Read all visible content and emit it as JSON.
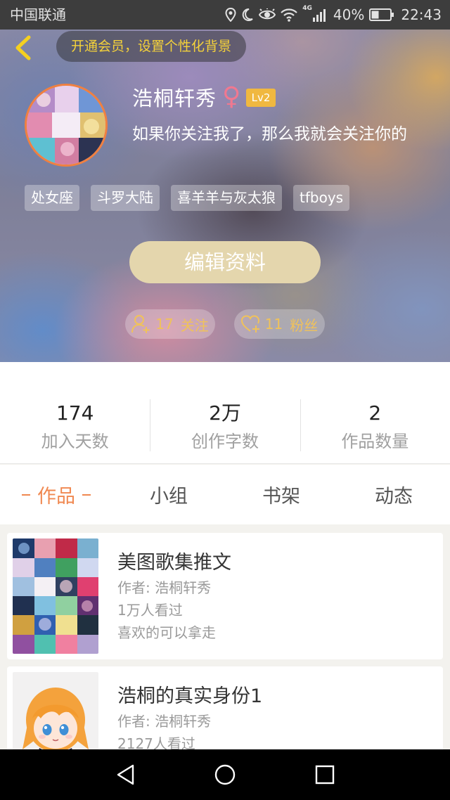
{
  "status_bar": {
    "carrier": "中国联通",
    "network": "4G",
    "battery": "40%",
    "time": "22:43"
  },
  "header": {
    "vip_prompt": "开通会员，设置个性化背景"
  },
  "profile": {
    "name": "浩桐轩秀",
    "gender_symbol": "♀",
    "level": "Lv2",
    "bio": "如果你关注我了，那么我就会关注你的",
    "tags": [
      "处女座",
      "斗罗大陆",
      "喜羊羊与灰太狼",
      "tfboys"
    ],
    "edit_button": "编辑资料",
    "following": {
      "count": "17",
      "label": "关注"
    },
    "followers": {
      "count": "11",
      "label": "粉丝"
    }
  },
  "stats": [
    {
      "value": "174",
      "label": "加入天数"
    },
    {
      "value": "2万",
      "label": "创作字数"
    },
    {
      "value": "2",
      "label": "作品数量"
    }
  ],
  "tabs": [
    {
      "label": "作品",
      "active": true
    },
    {
      "label": "小组",
      "active": false
    },
    {
      "label": "书架",
      "active": false
    },
    {
      "label": "动态",
      "active": false
    }
  ],
  "works": [
    {
      "title": "美图歌集推文",
      "author": "作者: 浩桐轩秀",
      "views": "1万人看过",
      "description": "喜欢的可以拿走"
    },
    {
      "title": "浩桐的真实身份1",
      "author": "作者: 浩桐轩秀",
      "views": "2127人看过"
    }
  ],
  "colors": {
    "accent": "#f08850",
    "vip": "#f5d23a",
    "back": "#f5d020",
    "lv": "#f0b840",
    "gender": "#f07890",
    "edit": "#e4d6ad",
    "follow": "#f0c25a",
    "avatar-border": "#f08040"
  },
  "icons": {
    "status": [
      "location-icon",
      "moon-icon",
      "eye-icon",
      "wifi-icon",
      "signal-icon",
      "battery-icon"
    ],
    "back": "chevron-left-icon",
    "following": "user-plus-icon",
    "followers": "heart-plus-icon",
    "nav": [
      "nav-back-icon",
      "nav-home-icon",
      "nav-recents-icon"
    ]
  }
}
